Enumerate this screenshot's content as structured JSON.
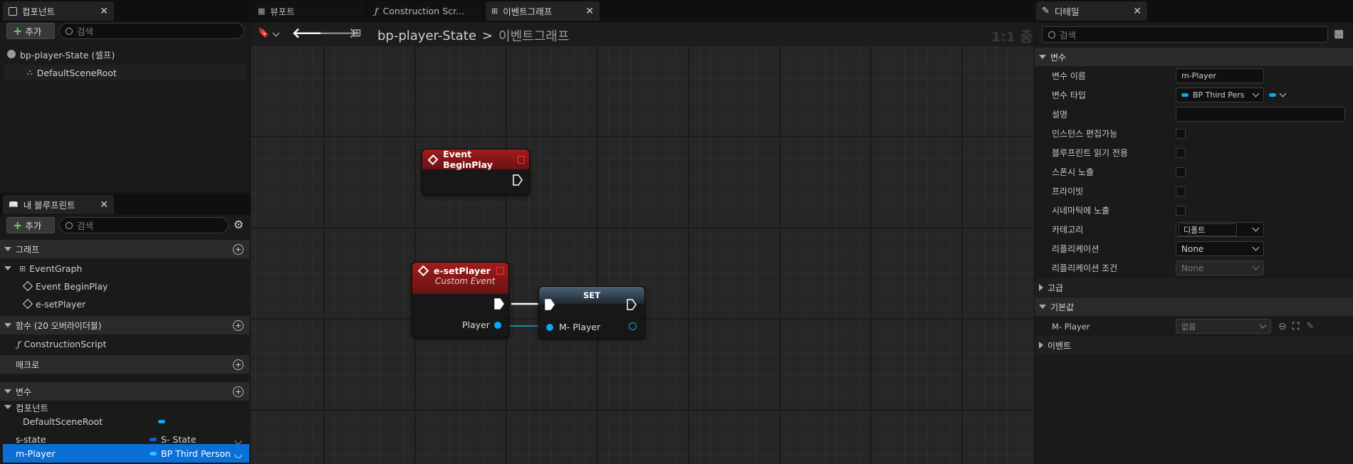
{
  "components_panel": {
    "tab_label": "컴포넌트",
    "add_label": "추가",
    "search_placeholder": "검색",
    "root_item": "bp-player-State (셀프)",
    "child_item": "DefaultSceneRoot"
  },
  "blueprint_panel": {
    "tab_label": "내 블루프린트",
    "add_label": "추가",
    "search_placeholder": "검색",
    "graph_section": "그래프",
    "event_graph": "EventGraph",
    "events": [
      "Event BeginPlay",
      "e-setPlayer"
    ],
    "functions_section": "함수 (20 오버라이더블)",
    "construction_script": "ConstructionScript",
    "macros_section": "매크로",
    "variables_section": "변수",
    "components_category": "컴포넌트",
    "variables": [
      {
        "name": "DefaultSceneRoot",
        "type": ""
      },
      {
        "name": "s-state",
        "type": "S- State"
      },
      {
        "name": "m-Player",
        "type": "BP Third Person"
      }
    ]
  },
  "center": {
    "tabs": [
      "뷰포트",
      "Construction Scr...",
      "이벤트그래프"
    ],
    "breadcrumb_root": "bp-player-State",
    "breadcrumb_sep": ">",
    "breadcrumb_current": "이벤트그래프",
    "zoom": "1:1 줌"
  },
  "nodes": {
    "begin_play": {
      "title": "Event BeginPlay"
    },
    "set_player": {
      "title": "e-setPlayer",
      "subtitle": "Custom Event",
      "pin": "Player"
    },
    "set_node": {
      "title": "SET",
      "pin": "M- Player"
    }
  },
  "details": {
    "tab_label": "디테일",
    "search_placeholder": "검색",
    "variable_section": "변수",
    "rows": {
      "var_name_label": "변수 이름",
      "var_name_value": "m-Player",
      "var_type_label": "변수 타입",
      "var_type_value": "BP Third Pers",
      "desc_label": "설명",
      "instance_editable": "인스턴스 편집가능",
      "bp_readonly": "블루프린트 읽기 전용",
      "expose_spawn": "스폰시 노출",
      "private": "프라이빗",
      "expose_cine": "시네마틱에 노출",
      "category_label": "카테고리",
      "category_value": "디폴트",
      "replication_label": "리플리케이션",
      "replication_value": "None",
      "rep_condition_label": "리플리케이션 조건",
      "rep_condition_value": "None"
    },
    "advanced_section": "고급",
    "default_section": "기본값",
    "default_label": "M- Player",
    "default_value": "없음",
    "events_section": "이벤트"
  },
  "colors": {
    "accent": "#0a70d8",
    "node_red": "#8a1a1a",
    "pin_blue": "#0aa8f0"
  }
}
